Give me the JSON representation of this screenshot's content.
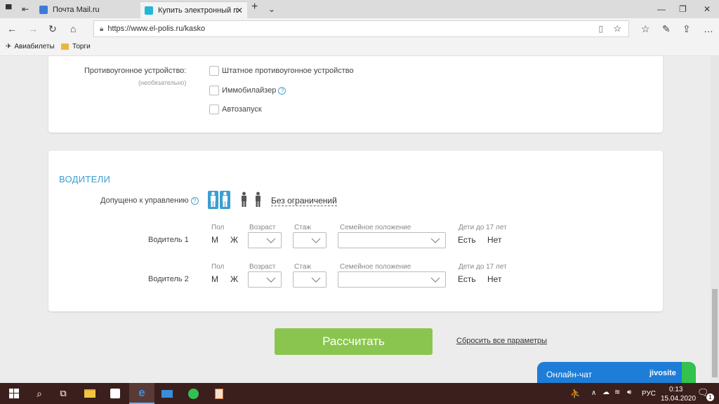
{
  "browser": {
    "tabs": [
      {
        "title": "Почта Mail.ru",
        "active": false
      },
      {
        "title": "Купить электронный п",
        "active": true
      }
    ],
    "url": "https://www.el-polis.ru/kasko",
    "bookmarks": [
      "Авиабилеты",
      "Торги"
    ]
  },
  "antitheft": {
    "label": "Противоугонное устройство:",
    "sublabel": "(необязательно)",
    "options": [
      "Штатное противоугонное устройство",
      "Иммобилайзер",
      "Автозапуск"
    ],
    "help": "?"
  },
  "drivers": {
    "section_title": "ВОДИТЕЛИ",
    "allowed_label": "Допущено к управлению",
    "help": "?",
    "no_limit": "Без ограничений",
    "columns": [
      "Пол",
      "Возраст",
      "Стаж",
      "Семейное положение",
      "Дети до 17 лет"
    ],
    "rows": [
      {
        "label": "Водитель 1",
        "sex_m": "М",
        "sex_f": "Ж",
        "kids_yes": "Есть",
        "kids_no": "Нет"
      },
      {
        "label": "Водитель 2",
        "sex_m": "М",
        "sex_f": "Ж",
        "kids_yes": "Есть",
        "kids_no": "Нет"
      }
    ]
  },
  "actions": {
    "calculate": "Рассчитать",
    "reset": "Сбросить все параметры"
  },
  "chat": {
    "label": "Онлайн-чат",
    "brand": "jivosite"
  },
  "taskbar": {
    "lang": "РУС",
    "time": "0:13",
    "date": "15.04.2020",
    "notifications": "1"
  },
  "colors": {
    "accent_blue": "#3a9fd1",
    "button_green": "#8ac64f",
    "chat_blue": "#1e7dd6"
  }
}
